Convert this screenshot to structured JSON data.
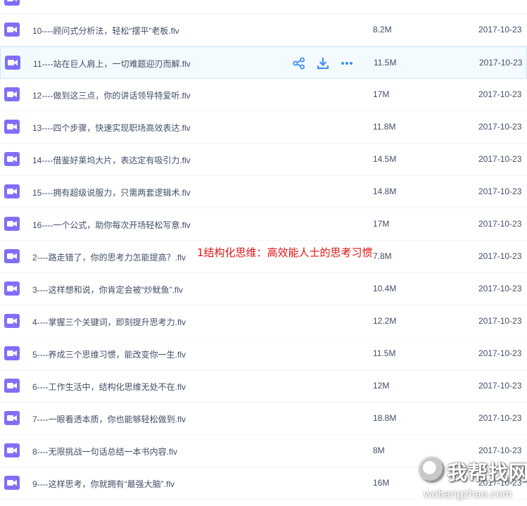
{
  "files": [
    {
      "name": "",
      "size": "",
      "date": ""
    },
    {
      "name": "10----顾问式分析法，轻松“摆平”老板.flv",
      "size": "8.2M",
      "date": "2017-10-23"
    },
    {
      "name": "11----站在巨人肩上，一切难题迎刃而解.flv",
      "size": "11.5M",
      "date": "2017-10-23"
    },
    {
      "name": "12----做到这三点，你的讲话领导特爱听.flv",
      "size": "17M",
      "date": "2017-10-23"
    },
    {
      "name": "13----四个步骤，快速实现职场高效表达.flv",
      "size": "11.8M",
      "date": "2017-10-23"
    },
    {
      "name": "14----借鉴好莱坞大片，表达定有吸引力.flv",
      "size": "14.5M",
      "date": "2017-10-23"
    },
    {
      "name": "15----拥有超级说服力，只需两套逻辑术.flv",
      "size": "14.8M",
      "date": "2017-10-23"
    },
    {
      "name": "16----一个公式，助你每次开场轻松写意.flv",
      "size": "17M",
      "date": "2017-10-23"
    },
    {
      "name": "2----路走错了，你的思考力怎能提高？.flv",
      "size": "7.8M",
      "date": "2017-10-23"
    },
    {
      "name": "3----这样想和说，你肯定会被“炒鱿鱼”.flv",
      "size": "10.4M",
      "date": "2017-10-23"
    },
    {
      "name": "4----掌握三个关键词，即刻提升思考力.flv",
      "size": "12.2M",
      "date": "2017-10-23"
    },
    {
      "name": "5----养成三个思维习惯，能改变你一生.flv",
      "size": "11.5M",
      "date": "2017-10-23"
    },
    {
      "name": "6----工作生活中，结构化思维无处不在.flv",
      "size": "12M",
      "date": "2017-10-23"
    },
    {
      "name": "7----一眼看透本质，你也能够轻松做到.flv",
      "size": "18.8M",
      "date": "2017-10-23"
    },
    {
      "name": "8----无限挑战一句话总结一本书内容.flv",
      "size": "8M",
      "date": "2017-10-23"
    },
    {
      "name": "9----这样思考，你就拥有“最强大脑”.flv",
      "size": "16M",
      "date": "2017-10-23"
    }
  ],
  "hover_index": 2,
  "overlay_text": "1结构化思维：高效能人士的思考习惯",
  "watermark": {
    "title": "我帮找网",
    "subtitle": "wobangzhao.com"
  },
  "colors": {
    "file_icon": "#7f6ff7",
    "action_icon": "#3b8cff",
    "overlay": "#e11414"
  },
  "icons": {
    "file": "video-file-icon",
    "actions": [
      "share-icon",
      "download-icon",
      "more-icon"
    ]
  }
}
